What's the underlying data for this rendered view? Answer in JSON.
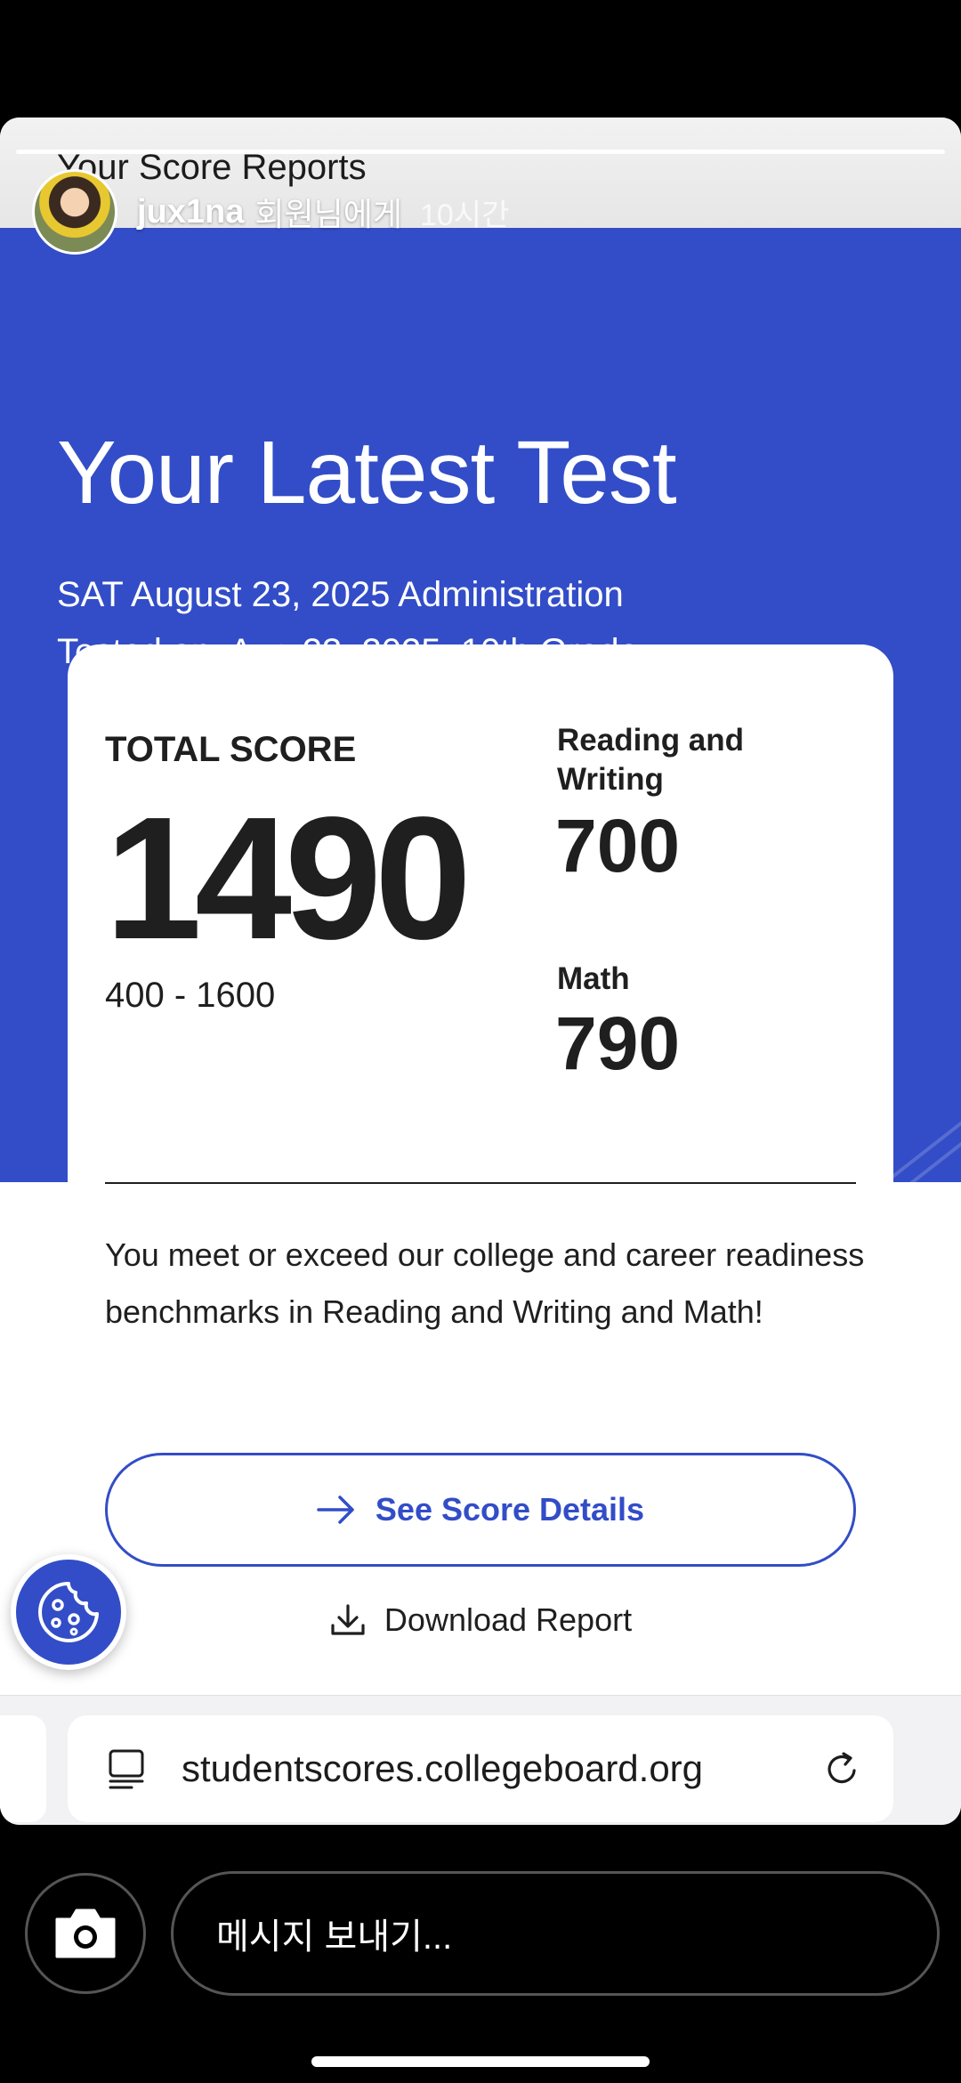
{
  "story": {
    "author": "jux1na",
    "author_suffix": "회원님에게",
    "time": "10시간"
  },
  "page": {
    "header_title": "Your Score Reports"
  },
  "hero": {
    "title": "Your Latest Test",
    "administration": "SAT August 23, 2025 Administration",
    "tested_on": "Tested on: Aug 23, 2025, 10th Grade"
  },
  "scores": {
    "total_label": "TOTAL SCORE",
    "total": "1490",
    "range": "400 - 1600",
    "sections": [
      {
        "label": "Reading and Writing",
        "score": "700"
      },
      {
        "label": "Math",
        "score": "790"
      }
    ],
    "message": "You meet or exceed our college and career readiness benchmarks in Reading and Writing and Math!"
  },
  "actions": {
    "see_details": "See Score Details",
    "download": "Download Report"
  },
  "browser": {
    "url": "studentscores.collegeboard.org"
  },
  "reply": {
    "placeholder": "메시지 보내기..."
  },
  "colors": {
    "brand_blue": "#324dc7",
    "text": "#1f1f1f"
  }
}
